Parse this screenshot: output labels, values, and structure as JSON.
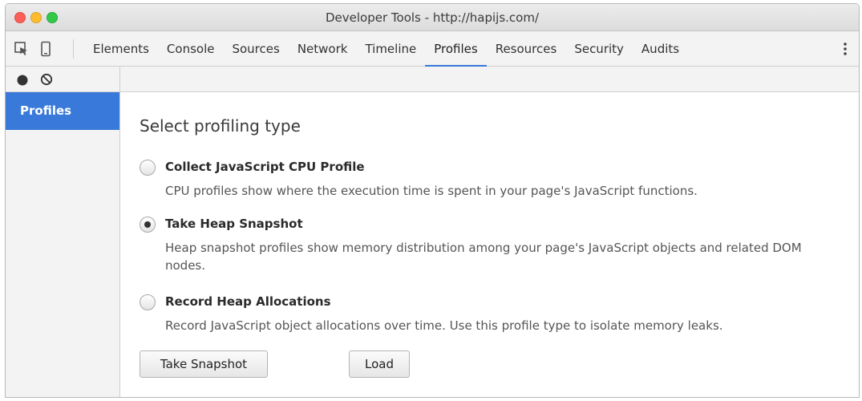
{
  "window": {
    "title": "Developer Tools - http://hapijs.com/"
  },
  "toolbar": {
    "tabs": [
      {
        "label": "Elements"
      },
      {
        "label": "Console"
      },
      {
        "label": "Sources"
      },
      {
        "label": "Network"
      },
      {
        "label": "Timeline"
      },
      {
        "label": "Profiles",
        "active": true
      },
      {
        "label": "Resources"
      },
      {
        "label": "Security"
      },
      {
        "label": "Audits"
      }
    ],
    "icons": [
      "inspect-element-icon",
      "device-mode-icon",
      "more-options-icon"
    ]
  },
  "sidebar": {
    "tool_icons": [
      "record-icon",
      "clear-icon"
    ],
    "items": [
      {
        "label": "Profiles",
        "selected": true
      }
    ]
  },
  "main": {
    "heading": "Select profiling type",
    "options": [
      {
        "label": "Collect JavaScript CPU Profile",
        "description": "CPU profiles show where the execution time is spent in your page's JavaScript functions.",
        "checked": false
      },
      {
        "label": "Take Heap Snapshot",
        "description": "Heap snapshot profiles show memory distribution among your page's JavaScript objects and related DOM nodes.",
        "checked": true
      },
      {
        "label": "Record Heap Allocations",
        "description": "Record JavaScript object allocations over time. Use this profile type to isolate memory leaks.",
        "checked": false
      }
    ],
    "buttons": {
      "primary": "Take Snapshot",
      "secondary": "Load"
    }
  },
  "colors": {
    "accent": "#3879d9",
    "close": "#fc5f57",
    "minimize": "#fdbc2e",
    "maximize": "#34c84a"
  }
}
